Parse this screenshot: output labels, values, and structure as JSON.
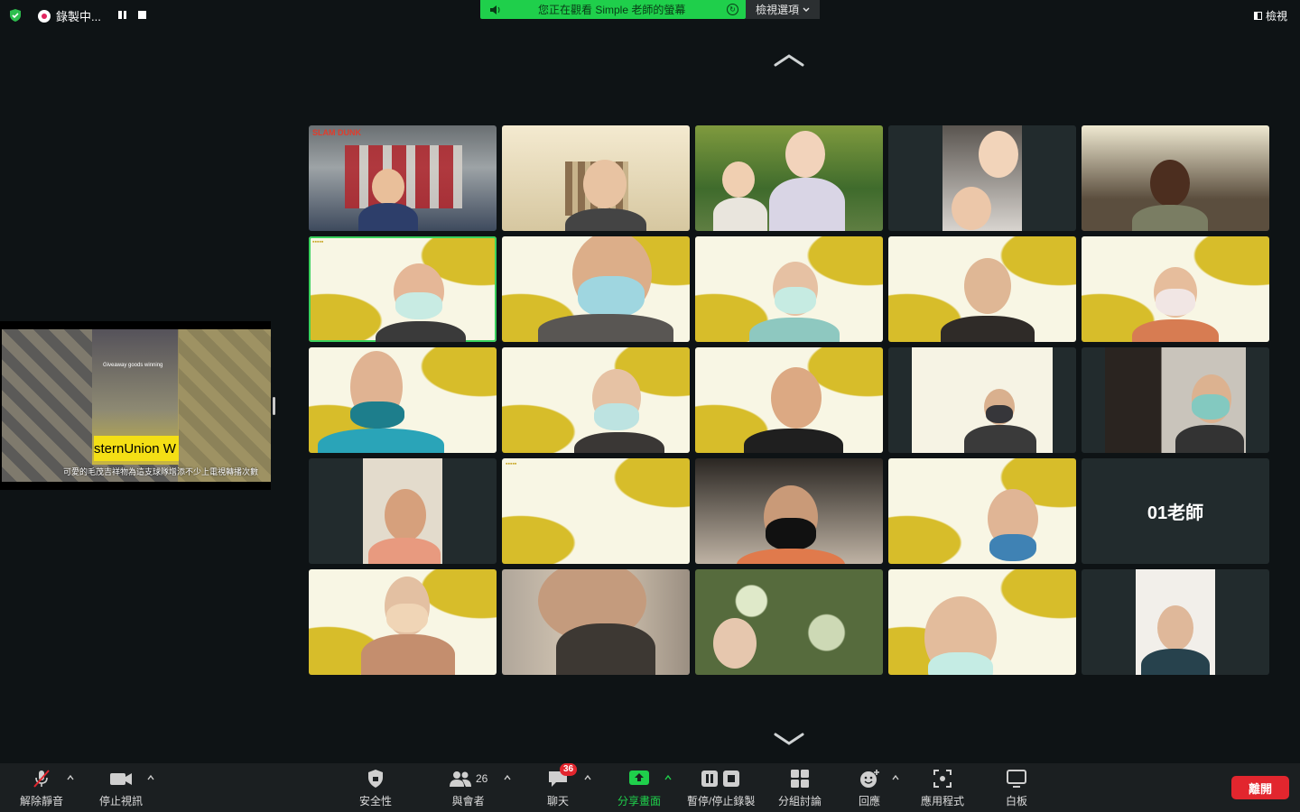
{
  "topbar": {
    "recording_label": "錄製中...",
    "banner_text": "您正在觀看 Simple 老師的螢幕",
    "view_options_label": "檢視選項",
    "view_label": "檢視"
  },
  "shared_screen": {
    "caption": "可愛的毛茂吉祥物為這支球隊增添不少上電視轉播次數",
    "banner_text": "sternUnion W",
    "small_text": "Giveaway goods winning"
  },
  "gallery": {
    "tiles": [
      {
        "label": "SLAM DUNK"
      },
      {
        "label": ""
      },
      {
        "label": ""
      },
      {
        "label": ""
      },
      {
        "label": ""
      },
      {
        "label": ""
      },
      {
        "label": ""
      },
      {
        "label": ""
      },
      {
        "label": ""
      },
      {
        "label": ""
      },
      {
        "label": ""
      },
      {
        "label": ""
      },
      {
        "label": ""
      },
      {
        "label": ""
      },
      {
        "label": ""
      },
      {
        "label": ""
      },
      {
        "label": ""
      },
      {
        "label": ""
      },
      {
        "label": ""
      },
      {
        "label": "01老師"
      },
      {
        "label": ""
      },
      {
        "label": ""
      },
      {
        "label": ""
      },
      {
        "label": ""
      },
      {
        "label": ""
      }
    ]
  },
  "toolbar": {
    "unmute": "解除靜音",
    "stop_video": "停止視訊",
    "security": "安全性",
    "participants": "與會者",
    "participants_count": "26",
    "chat": "聊天",
    "chat_badge": "36",
    "share": "分享畫面",
    "record": "暫停/停止錄製",
    "breakout": "分組討論",
    "reactions": "回應",
    "apps": "應用程式",
    "whiteboard": "白板",
    "leave": "離開"
  },
  "colors": {
    "accent_green": "#1fcf4b",
    "leave_red": "#e2262e",
    "background": "#0e1315"
  }
}
